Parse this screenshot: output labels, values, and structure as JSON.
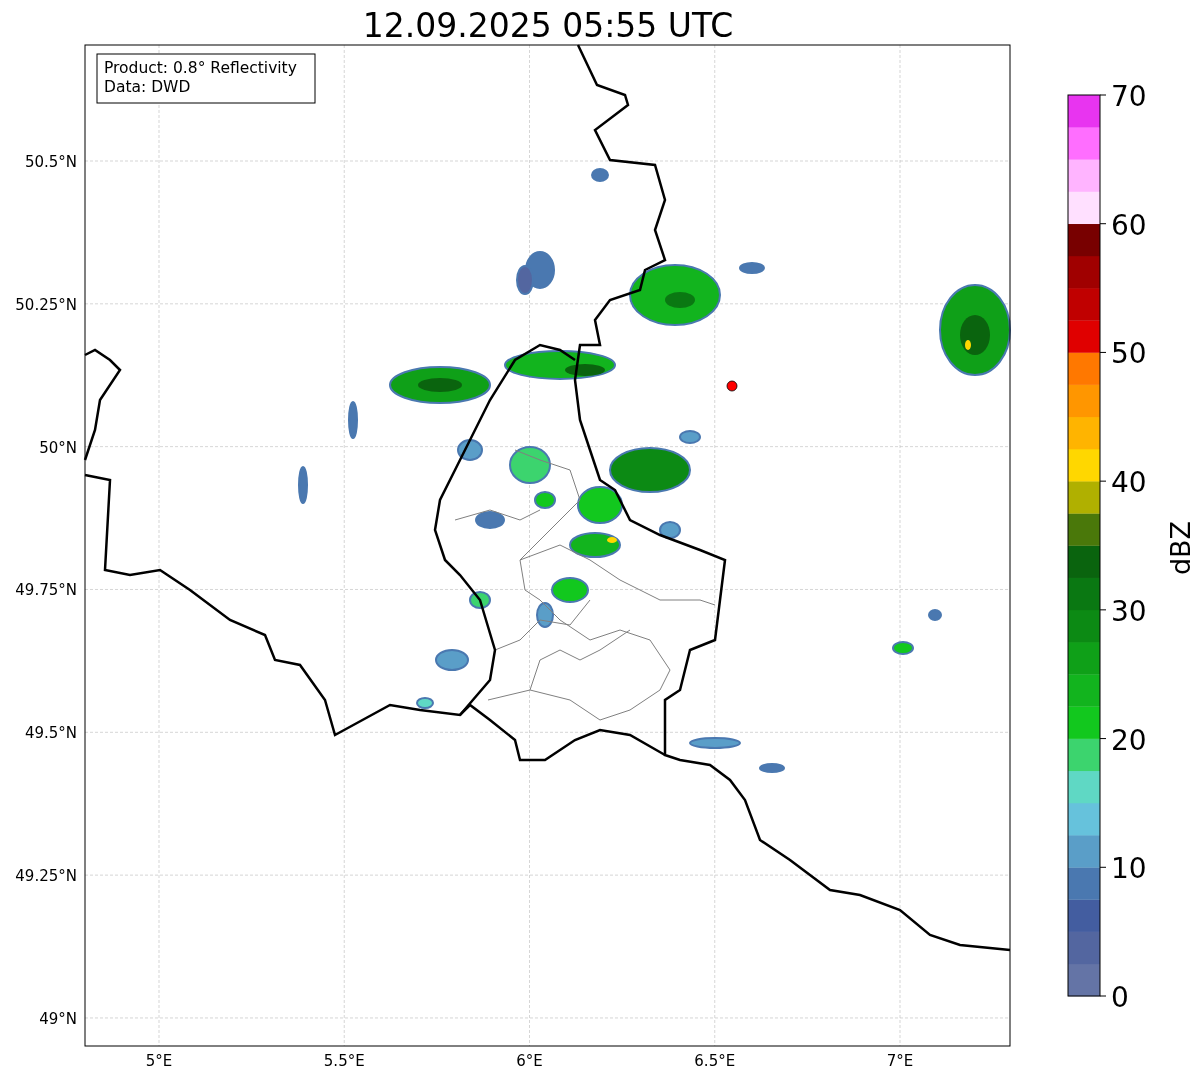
{
  "title": "12.09.2025 05:55 UTC",
  "info_box": {
    "lines": [
      "Product: 0.8° Reflectivity",
      "Data: DWD"
    ]
  },
  "map": {
    "lat_labels": [
      "50.5°N",
      "50.25°N",
      "50°N",
      "49.75°N",
      "49.5°N",
      "49.25°N",
      "49°N"
    ],
    "lon_labels": [
      "5°E",
      "5.5°E",
      "6°E",
      "6.5°E",
      "7°E"
    ]
  },
  "colorbar": {
    "label": "dBZ",
    "ticks": [
      "70",
      "60",
      "50",
      "40",
      "30",
      "20",
      "10",
      "0"
    ],
    "segments": [
      {
        "color": "#6474a6"
      },
      {
        "color": "#5366a0"
      },
      {
        "color": "#435da0"
      },
      {
        "color": "#4a78b0"
      },
      {
        "color": "#5a9ec8"
      },
      {
        "color": "#66c2dc"
      },
      {
        "color": "#5fd8c4"
      },
      {
        "color": "#3cd46e"
      },
      {
        "color": "#12c81e"
      },
      {
        "color": "#12b41e"
      },
      {
        "color": "#0fa018"
      },
      {
        "color": "#0c8a14"
      },
      {
        "color": "#0a7812"
      },
      {
        "color": "#0a640e"
      },
      {
        "color": "#4a780a"
      },
      {
        "color": "#b0b000"
      },
      {
        "color": "#ffd700"
      },
      {
        "color": "#ffb400"
      },
      {
        "color": "#ff9600"
      },
      {
        "color": "#ff7800"
      },
      {
        "color": "#e00000"
      },
      {
        "color": "#c00000"
      },
      {
        "color": "#a00000"
      },
      {
        "color": "#780000"
      },
      {
        "color": "#ffe0ff"
      },
      {
        "color": "#ffb4ff"
      },
      {
        "color": "#ff6eff"
      },
      {
        "color": "#e834f0"
      }
    ]
  }
}
